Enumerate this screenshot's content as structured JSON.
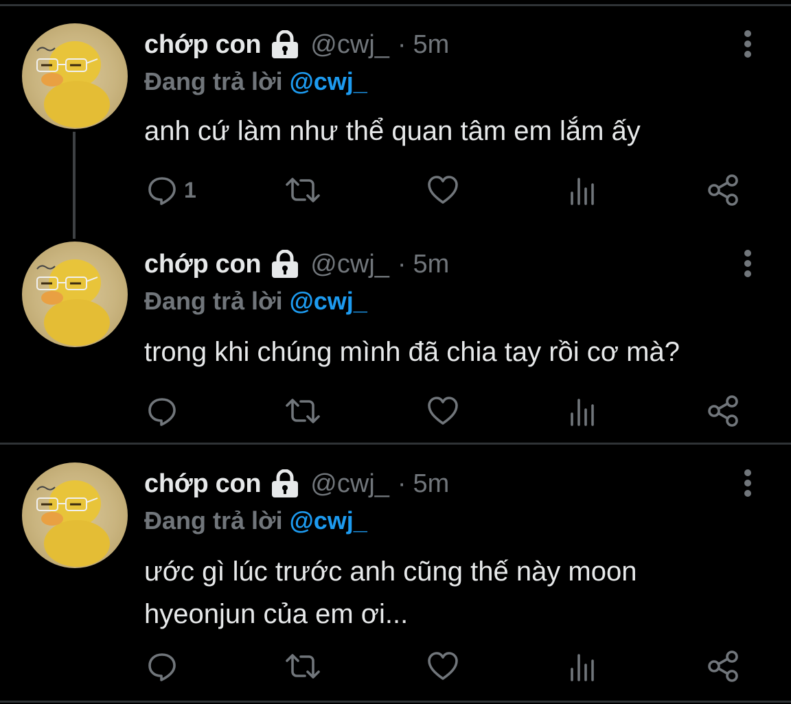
{
  "theme": {
    "background": "#000000",
    "text": "#e7e9ea",
    "muted": "#71767b",
    "link": "#1d9bf0",
    "divider": "#2f3336"
  },
  "tweets": [
    {
      "name": "chớp con",
      "protected_icon": "lock-icon",
      "handle": "@cwj_",
      "separator": "·",
      "time": "5m",
      "reply_label": "Đang trả lời",
      "reply_to": "@cwj_",
      "text": "anh cứ làm như thể quan tâm em lắm ấy",
      "reply_count": "1",
      "avatar_icon": "duck-avatar"
    },
    {
      "name": "chớp con",
      "protected_icon": "lock-icon",
      "handle": "@cwj_",
      "separator": "·",
      "time": "5m",
      "reply_label": "Đang trả lời",
      "reply_to": "@cwj_",
      "text": "trong khi chúng mình đã chia tay rồi cơ mà?",
      "reply_count": "",
      "avatar_icon": "duck-avatar"
    },
    {
      "name": "chớp con",
      "protected_icon": "lock-icon",
      "handle": "@cwj_",
      "separator": "·",
      "time": "5m",
      "reply_label": "Đang trả lời",
      "reply_to": "@cwj_",
      "text": "ước gì lúc trước anh cũng thế này moon hyeonjun của em ơi...",
      "reply_count": "",
      "avatar_icon": "duck-avatar"
    }
  ],
  "action_icons": [
    "reply-icon",
    "retweet-icon",
    "like-icon",
    "views-icon",
    "share-icon"
  ]
}
